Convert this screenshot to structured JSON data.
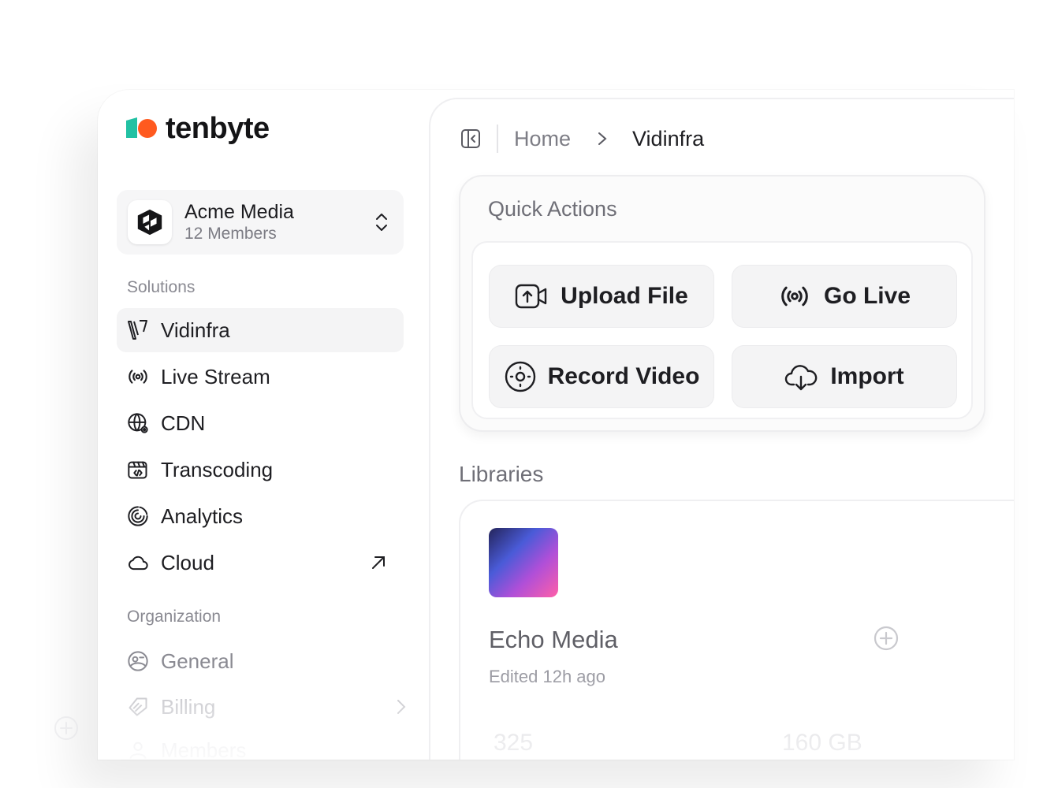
{
  "brand": {
    "name": "tenbyte",
    "colors": {
      "teal": "#22c1a3",
      "orange": "#ff5a1f"
    }
  },
  "workspace": {
    "name": "Acme Media",
    "members": "12 Members"
  },
  "sidebar": {
    "solutions_label": "Solutions",
    "items": [
      {
        "label": "Vidinfra",
        "icon": "vidinfra-icon",
        "active": true
      },
      {
        "label": "Live Stream",
        "icon": "broadcast-icon"
      },
      {
        "label": "CDN",
        "icon": "globe-icon"
      },
      {
        "label": "Transcoding",
        "icon": "clapperboard-code-icon"
      },
      {
        "label": "Analytics",
        "icon": "analytics-rings-icon"
      },
      {
        "label": "Cloud",
        "icon": "cloud-icon",
        "external": true
      }
    ],
    "organization_label": "Organization",
    "org_items": [
      {
        "label": "General",
        "icon": "settings-face-icon"
      },
      {
        "label": "Billing",
        "icon": "tag-icon"
      },
      {
        "label": "Members",
        "icon": "users-icon"
      }
    ]
  },
  "breadcrumb": {
    "home": "Home",
    "current": "Vidinfra"
  },
  "quick_actions": {
    "title": "Quick Actions",
    "buttons": [
      {
        "label": "Upload File",
        "icon": "upload-video-icon"
      },
      {
        "label": "Go Live",
        "icon": "broadcast-icon"
      },
      {
        "label": "Record Video",
        "icon": "record-icon"
      },
      {
        "label": "Import",
        "icon": "cloud-download-icon"
      }
    ]
  },
  "libraries": {
    "title": "Libraries",
    "card": {
      "name": "Echo Media",
      "edited": "Edited 12h ago",
      "videos": "325",
      "storage": "160 GB"
    }
  }
}
